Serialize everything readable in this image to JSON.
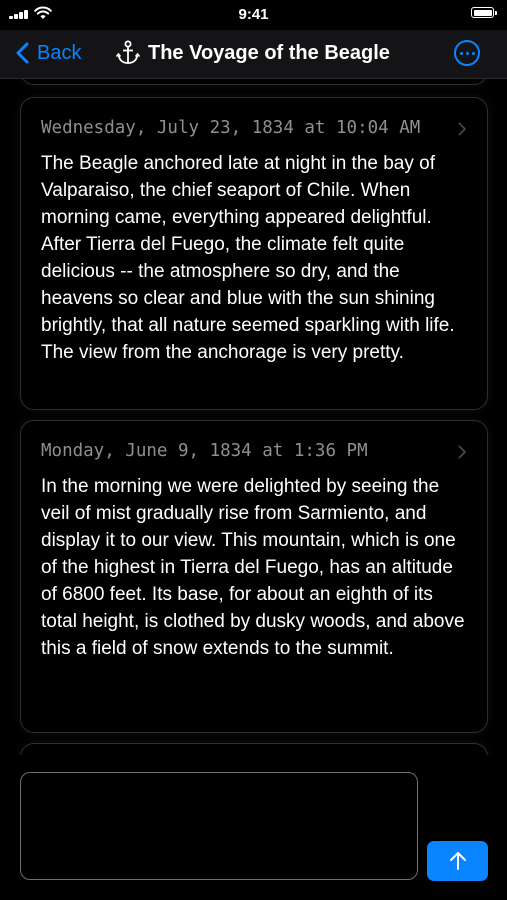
{
  "status_bar": {
    "time": "9:41"
  },
  "nav": {
    "back_label": "Back",
    "title": "The Voyage of the Beagle",
    "title_icon": "anchor-icon",
    "more_icon": "ellipsis-circle-icon",
    "accent_color": "#0a84ff"
  },
  "entries": [
    {
      "date": "Wednesday, July 23, 1834 at 10:04 AM",
      "text": "The Beagle anchored late at night in the bay of Valparaiso, the chief seaport of Chile. When morning came, everything appeared delightful. After Tierra del Fuego, the climate felt quite delicious -- the atmosphere so dry, and the heavens so clear and blue with the sun shining brightly, that all nature seemed sparkling with life. The view from the anchorage is very pretty."
    },
    {
      "date": "Monday, June 9, 1834 at 1:36 PM",
      "text": "In the morning we were delighted by seeing the veil of mist gradually rise from Sarmiento, and display it to our view. This mountain, which is one of the highest in Tierra del Fuego, has an altitude of 6800 feet. Its base, for about an eighth of its total height, is clothed by dusky woods, and above this a field of snow extends to the summit."
    }
  ],
  "composer": {
    "input_value": "",
    "send_icon": "arrow-up-icon"
  }
}
